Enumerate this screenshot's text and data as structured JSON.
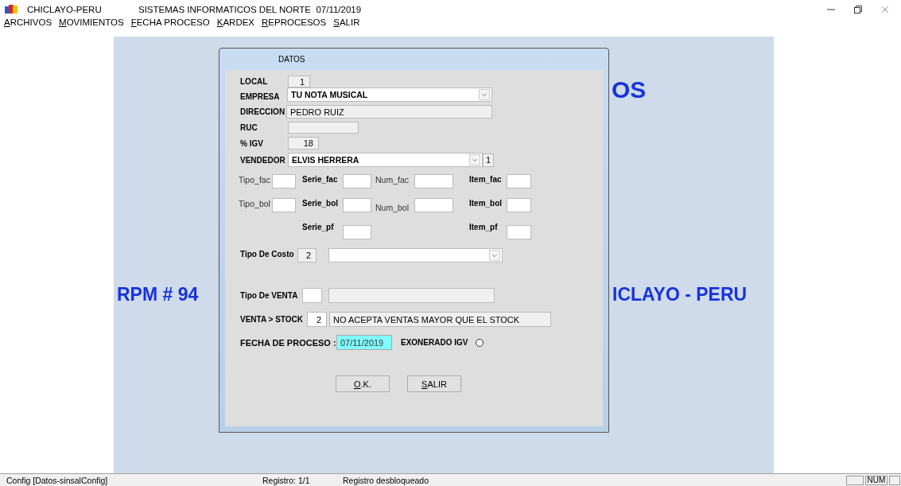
{
  "window": {
    "title": "CHICLAYO-PERU",
    "subtitle": "SISTEMAS INFORMATICOS DEL NORTE  07/11/2019"
  },
  "menu": [
    "ARCHIVOS",
    "MOVIMIENTOS",
    "FECHA PROCESO",
    "KARDEX",
    "REPROCESOS",
    "SALIR"
  ],
  "backdrop": {
    "heading": "OS",
    "left_text": "RPM # 94",
    "right_text": "ICLAYO - PERU"
  },
  "dialog": {
    "title": "DATOS",
    "local": {
      "label": "LOCAL",
      "value": "1"
    },
    "empresa": {
      "label": "EMPRESA",
      "value": "TU NOTA MUSICAL"
    },
    "direccion": {
      "label": "DIRECCION",
      "value": "PEDRO RUIZ"
    },
    "ruc": {
      "label": "RUC"
    },
    "igv": {
      "label": "% IGV",
      "value": "18"
    },
    "vendedor": {
      "label": "VENDEDOR",
      "value": "ELVIS HERRERA",
      "code": "1"
    },
    "counter_rows": [
      [
        "Tipo_fac",
        "Serie_fac",
        "Num_fac",
        "Item_fac"
      ],
      [
        "Tipo_bol",
        "Serie_bol",
        "Num_bol",
        "Item_bol"
      ],
      [
        null,
        "Serie_pf",
        null,
        "Item_pf"
      ]
    ],
    "tipo_costo": {
      "label": "Tipo De Costo",
      "value": "2"
    },
    "tipo_venta": {
      "label": "Tipo De VENTA"
    },
    "venta_stock": {
      "label": "VENTA > STOCK",
      "value": "2",
      "description": "NO ACEPTA VENTAS MAYOR QUE EL STOCK"
    },
    "fecha": {
      "label": "FECHA DE PROCESO :",
      "value": "07/11/2019"
    },
    "exonerado": {
      "label": "EXONERADO IGV",
      "checked": false
    },
    "buttons": [
      "O.K.",
      "SALIR"
    ]
  },
  "status_bar": {
    "left": "Config [Datos-sinsalConfig]",
    "record": "Registro: 1/1",
    "lock": "Registro desbloqueado",
    "indicator": "NUM"
  }
}
